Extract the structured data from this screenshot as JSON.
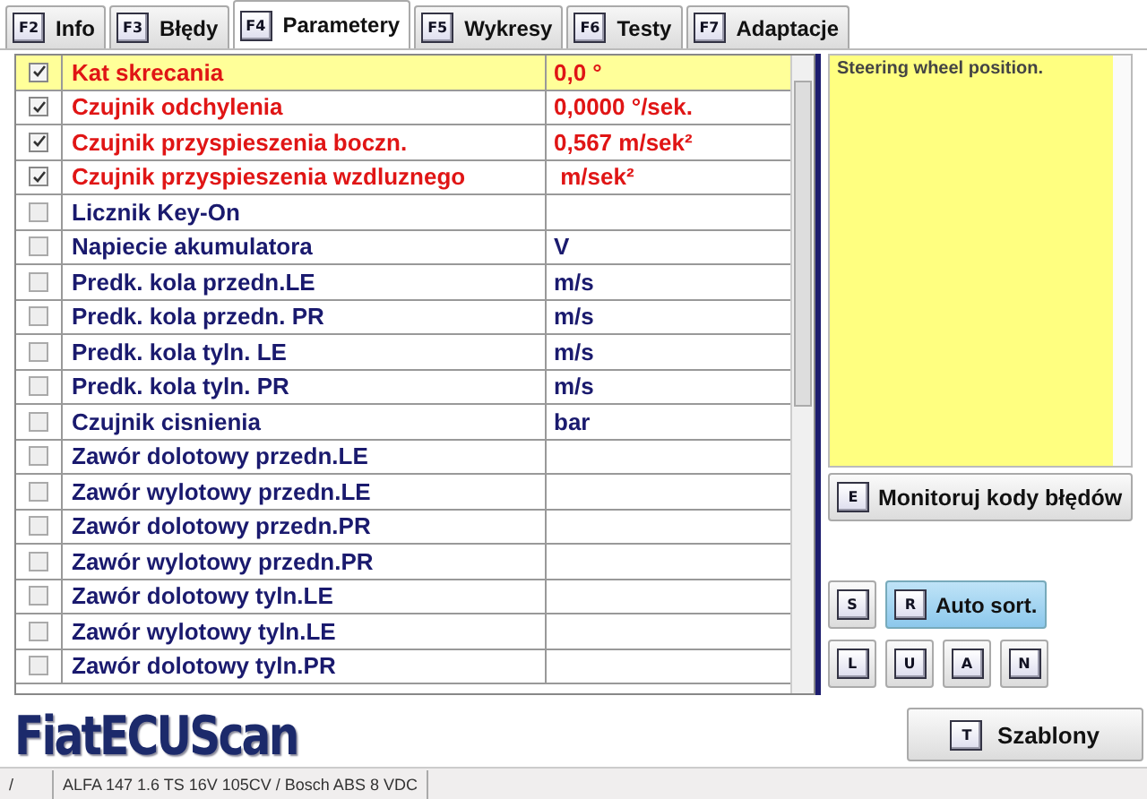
{
  "tabs": [
    {
      "key": "F2",
      "label": "Info",
      "selected": false
    },
    {
      "key": "F3",
      "label": "Błędy",
      "selected": false
    },
    {
      "key": "F4",
      "label": "Parametery",
      "selected": true
    },
    {
      "key": "F5",
      "label": "Wykresy",
      "selected": false
    },
    {
      "key": "F6",
      "label": "Testy",
      "selected": false
    },
    {
      "key": "F7",
      "label": "Adaptacje",
      "selected": false
    }
  ],
  "parameters": [
    {
      "name": "Kat skrecania",
      "value": "0,0 °",
      "checked": true,
      "selected": true
    },
    {
      "name": "Czujnik odchylenia",
      "value": "0,0000 °/sek.",
      "checked": true,
      "selected": false
    },
    {
      "name": "Czujnik przyspieszenia boczn.",
      "value": "0,567 m/sek²",
      "checked": true,
      "selected": false
    },
    {
      "name": "Czujnik przyspieszenia wzdluznego",
      "value": " m/sek²",
      "checked": true,
      "selected": false
    },
    {
      "name": "Licznik Key-On",
      "checked": false,
      "selected": false
    },
    {
      "name": "Napiecie akumulatora",
      "value": "V",
      "checked": false,
      "selected": false
    },
    {
      "name": "Predk. kola przedn.LE",
      "value": "m/s",
      "checked": false,
      "selected": false
    },
    {
      "name": "Predk. kola przedn. PR",
      "value": "m/s",
      "checked": false,
      "selected": false
    },
    {
      "name": "Predk. kola tyln. LE",
      "value": "m/s",
      "checked": false,
      "selected": false
    },
    {
      "name": "Predk. kola tyln. PR",
      "value": "m/s",
      "checked": false,
      "selected": false
    },
    {
      "name": "Czujnik cisnienia",
      "value": "bar",
      "checked": false,
      "selected": false
    },
    {
      "name": "Zawór dolotowy przedn.LE",
      "checked": false,
      "selected": false
    },
    {
      "name": "Zawór wylotowy przedn.LE",
      "checked": false,
      "selected": false
    },
    {
      "name": "Zawór dolotowy przedn.PR",
      "checked": false,
      "selected": false
    },
    {
      "name": "Zawór wylotowy przedn.PR",
      "checked": false,
      "selected": false
    },
    {
      "name": "Zawór dolotowy tyln.LE",
      "checked": false,
      "selected": false
    },
    {
      "name": "Zawór wylotowy tyln.LE",
      "checked": false,
      "selected": false
    },
    {
      "name": "Zawór dolotowy tyln.PR",
      "checked": false,
      "selected": false
    }
  ],
  "description": "Steering wheel position.",
  "monitor_button": {
    "key": "E",
    "label": "Monitoruj kody błędów"
  },
  "sort_buttons": [
    {
      "key": "S"
    },
    {
      "key": "R",
      "label": "Auto sort.",
      "selected": true
    }
  ],
  "letter_buttons": [
    {
      "key": "L"
    },
    {
      "key": "U"
    },
    {
      "key": "A"
    },
    {
      "key": "N"
    }
  ],
  "logo": "FiatECUScan",
  "templates_button": {
    "key": "T",
    "label": "Szablony"
  },
  "status_bar": [
    "/",
    "ALFA 147 1.6 TS 16V 105CV / Bosch ABS 8 VDC"
  ]
}
